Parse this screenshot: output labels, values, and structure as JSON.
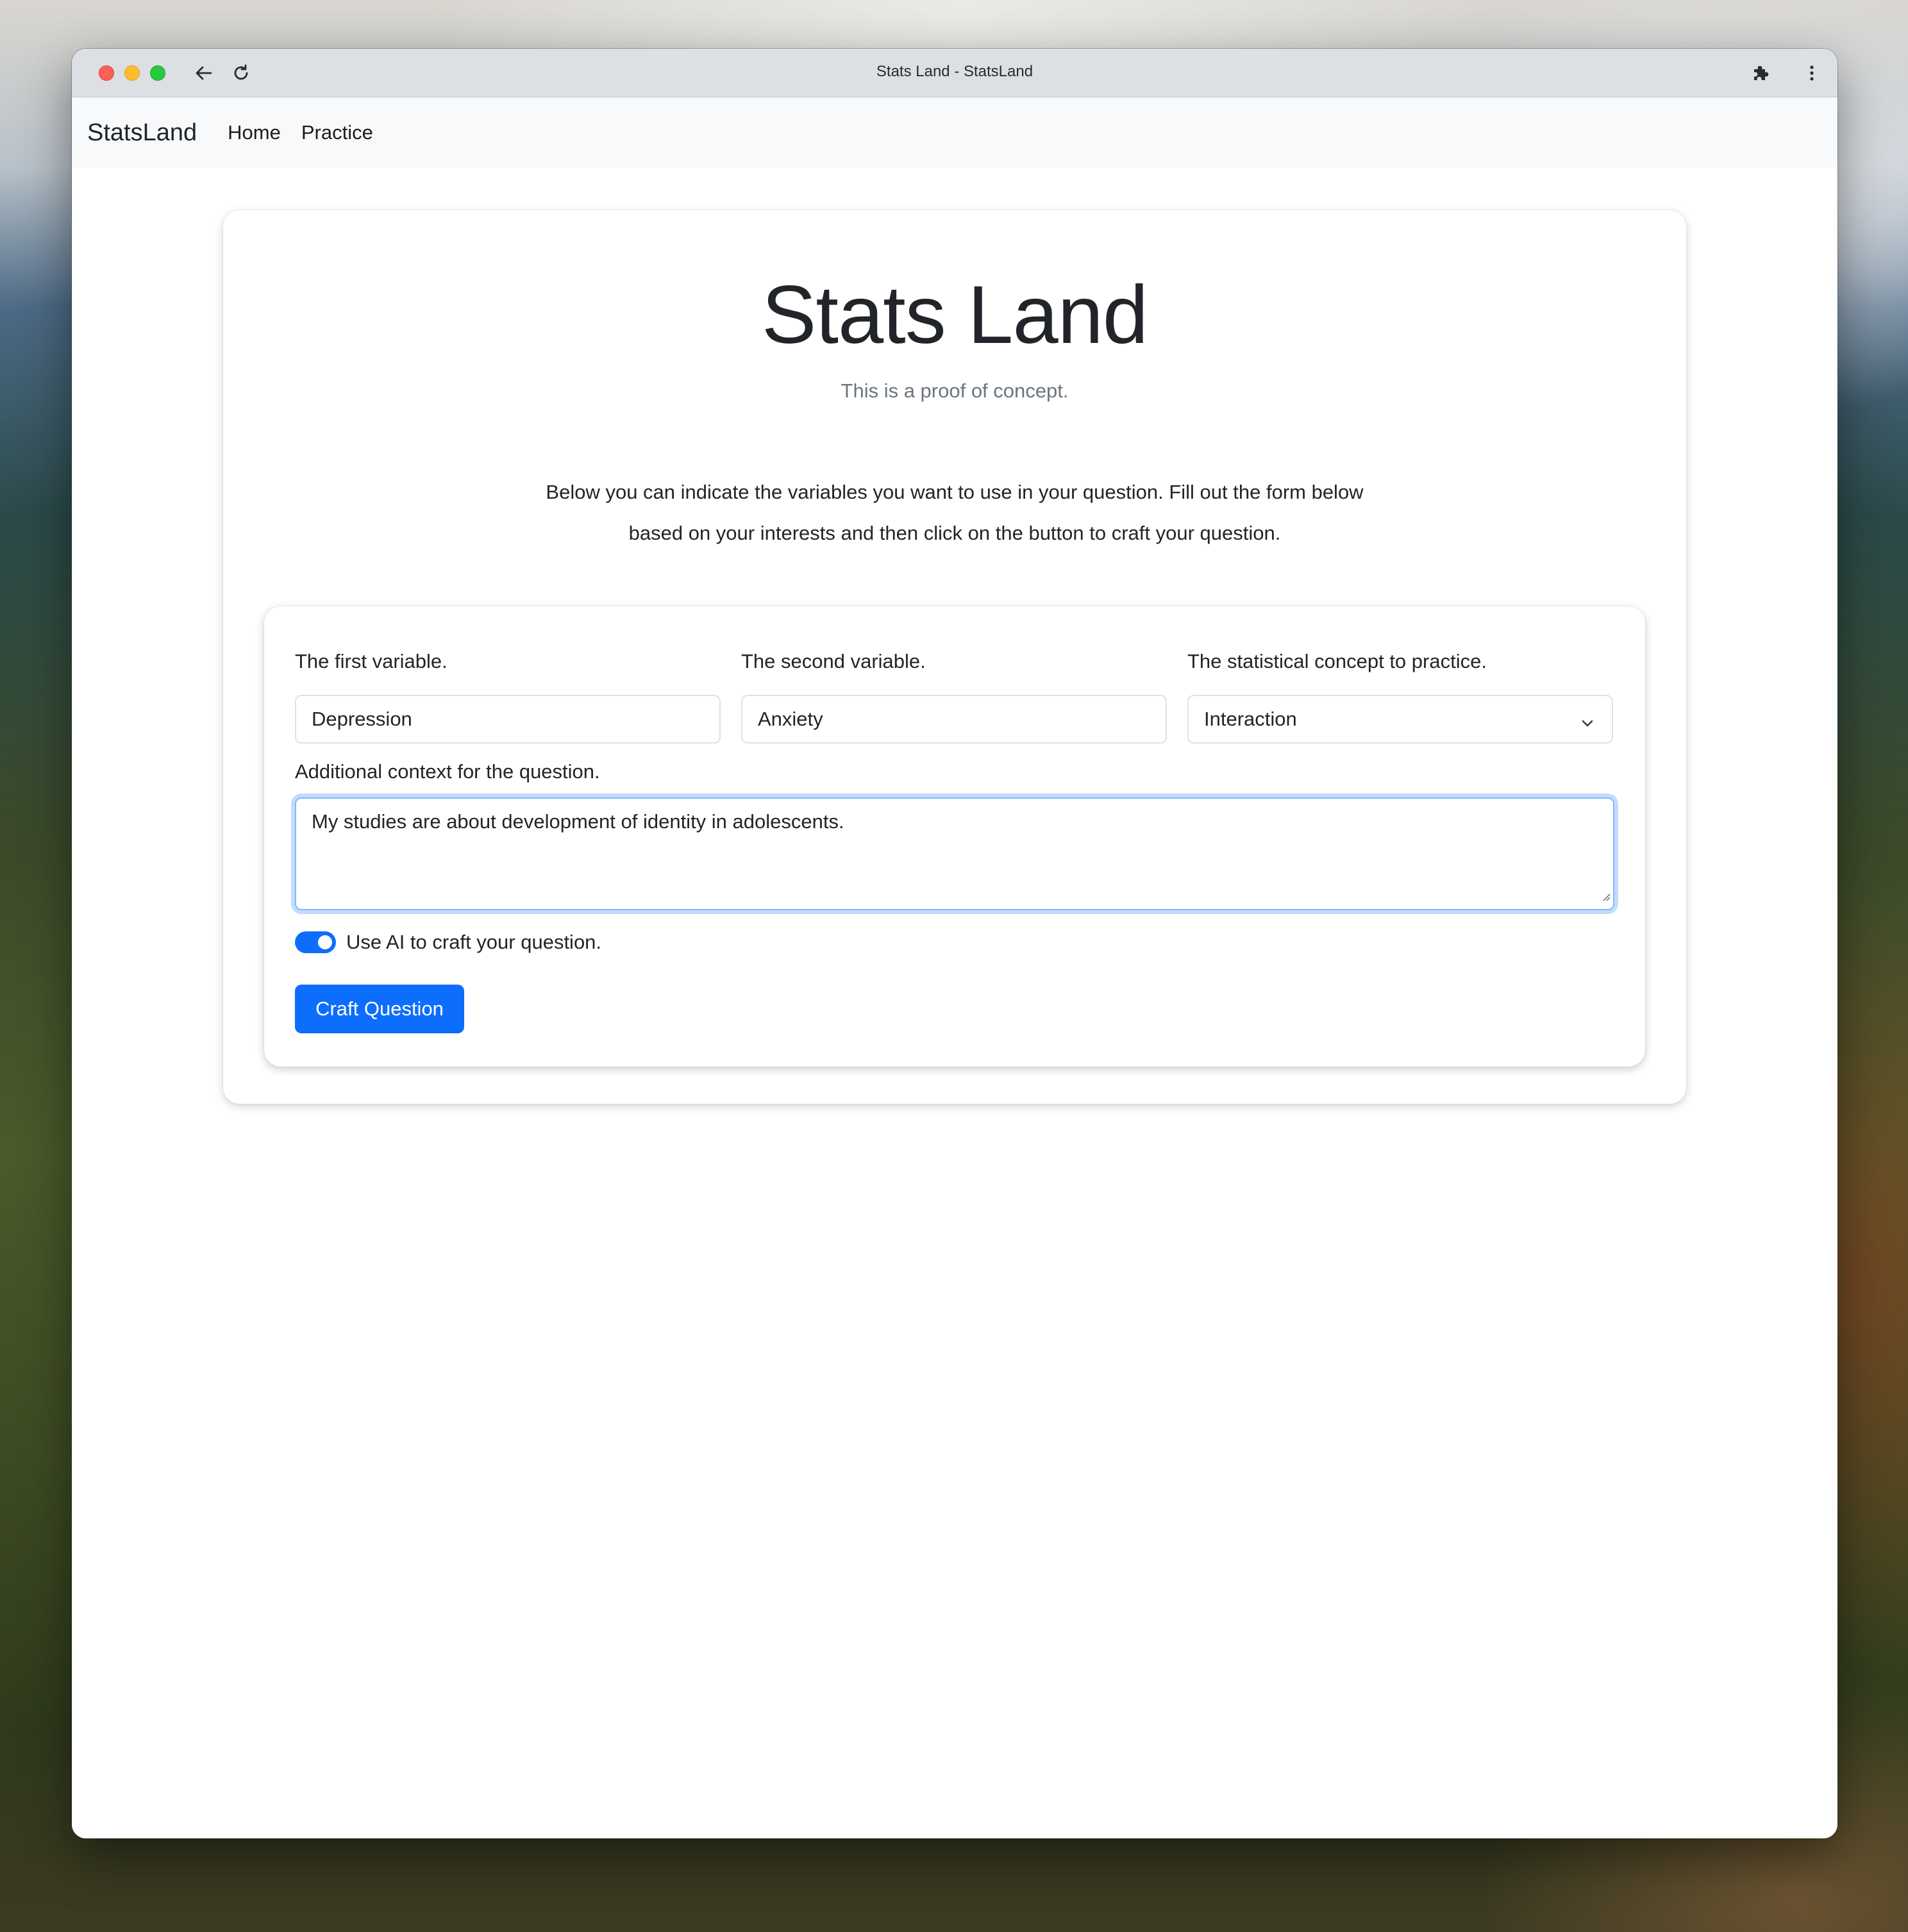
{
  "browser": {
    "window_title": "Stats Land - StatsLand"
  },
  "navbar": {
    "brand": "StatsLand",
    "links": [
      "Home",
      "Practice"
    ]
  },
  "hero": {
    "title": "Stats Land",
    "subtitle": "This is a proof of concept.",
    "intro_line1": "Below you can indicate the variables you want to use in your question. Fill out the form below",
    "intro_line2": "based on your interests and then click on the button to craft your question."
  },
  "form": {
    "first_variable_label": "The first variable.",
    "first_variable_value": "Depression",
    "second_variable_label": "The second variable.",
    "second_variable_value": "Anxiety",
    "concept_label": "The statistical concept to practice.",
    "concept_value": "Interaction",
    "context_label": "Additional context for the question.",
    "context_value": "My studies are about development of identity in adolescents.",
    "ai_toggle_label": "Use AI to craft your question.",
    "ai_toggle_on": true,
    "submit_label": "Craft Question"
  },
  "colors": {
    "primary": "#0d6efd",
    "navbar_bg": "#f8f9fa",
    "titlebar_bg": "#dcdfe4"
  },
  "icons": [
    "back-arrow-icon",
    "reload-icon",
    "extensions-puzzle-icon",
    "kebab-menu-icon",
    "chevron-down-icon",
    "resize-grip-icon"
  ]
}
